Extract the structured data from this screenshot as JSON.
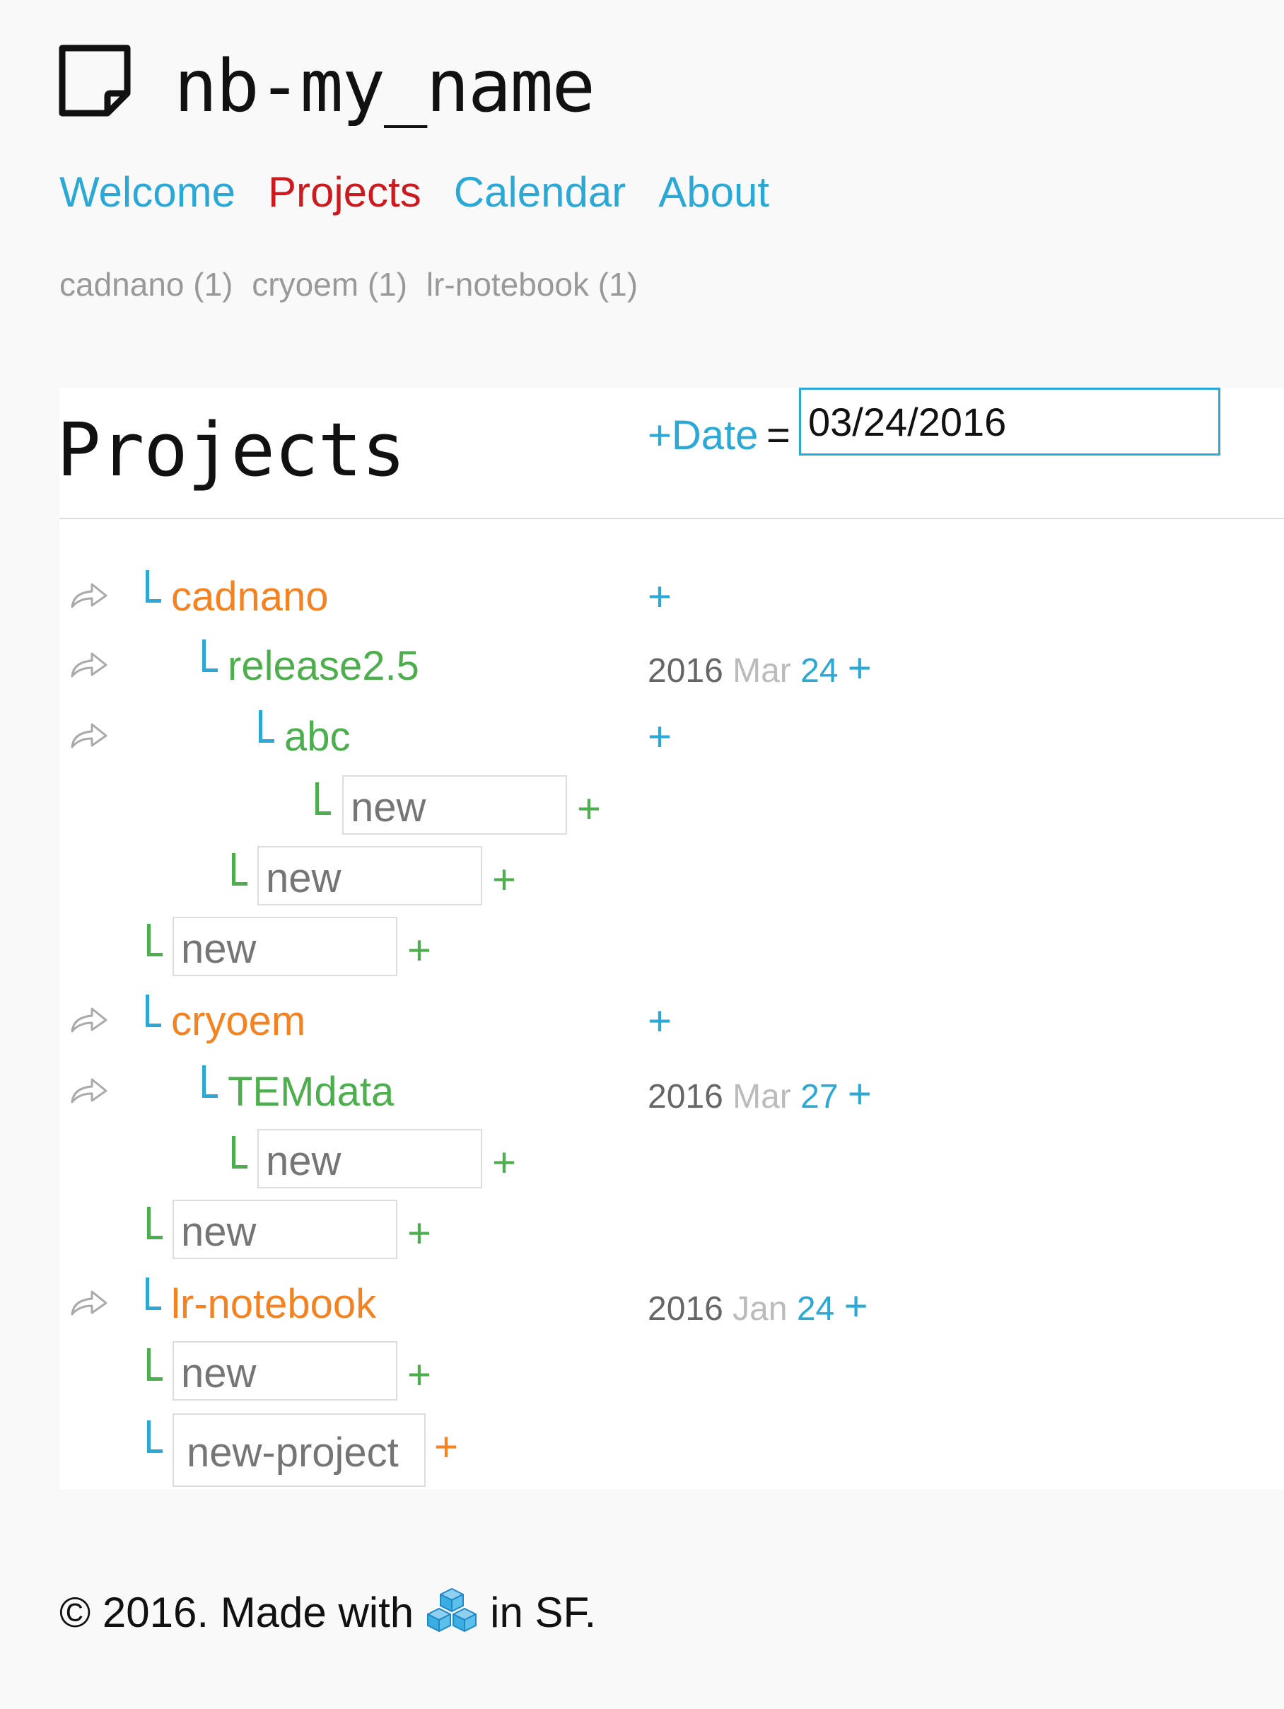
{
  "header": {
    "logo_icon": "note-icon",
    "site_title": "nb-my_name"
  },
  "nav": {
    "items": [
      "Welcome",
      "Projects",
      "Calendar",
      "About"
    ],
    "active": "Projects"
  },
  "tags": [
    "cadnano (1)",
    "cryoem (1)",
    "lr-notebook (1)"
  ],
  "panel": {
    "title": "Projects",
    "date_label": "+Date",
    "date_eq": "=",
    "date_value": "03/24/2016"
  },
  "tree": {
    "cadnano": {
      "name": "cadnano",
      "add": "+"
    },
    "release": {
      "name": "release2.5",
      "year": "2016",
      "month": "Mar",
      "day": "24",
      "add": "+"
    },
    "abc": {
      "name": "abc",
      "add": "+"
    },
    "abc_new": {
      "placeholder": "new",
      "add": "+"
    },
    "release_new": {
      "placeholder": "new",
      "add": "+"
    },
    "cadnano_new": {
      "placeholder": "new",
      "add": "+"
    },
    "cryoem": {
      "name": "cryoem",
      "add": "+"
    },
    "temdata": {
      "name": "TEMdata",
      "year": "2016",
      "month": "Mar",
      "day": "27",
      "add": "+"
    },
    "temdata_new": {
      "placeholder": "new",
      "add": "+"
    },
    "cryoem_new": {
      "placeholder": "new",
      "add": "+"
    },
    "lrnotebook": {
      "name": "lr-notebook",
      "year": "2016",
      "month": "Jan",
      "day": "24",
      "add": "+"
    },
    "lrnotebook_new": {
      "placeholder": "new",
      "add": "+"
    },
    "new_project": {
      "placeholder": "new-project",
      "add": "+"
    }
  },
  "footer": {
    "prefix": "© 2016. Made with",
    "icon": "cubes-icon",
    "suffix": "in SF."
  },
  "colors": {
    "link_blue": "#2aa8d6",
    "active_red": "#cc1a1f",
    "project_orange": "#f58220",
    "node_green": "#4cae4c"
  }
}
